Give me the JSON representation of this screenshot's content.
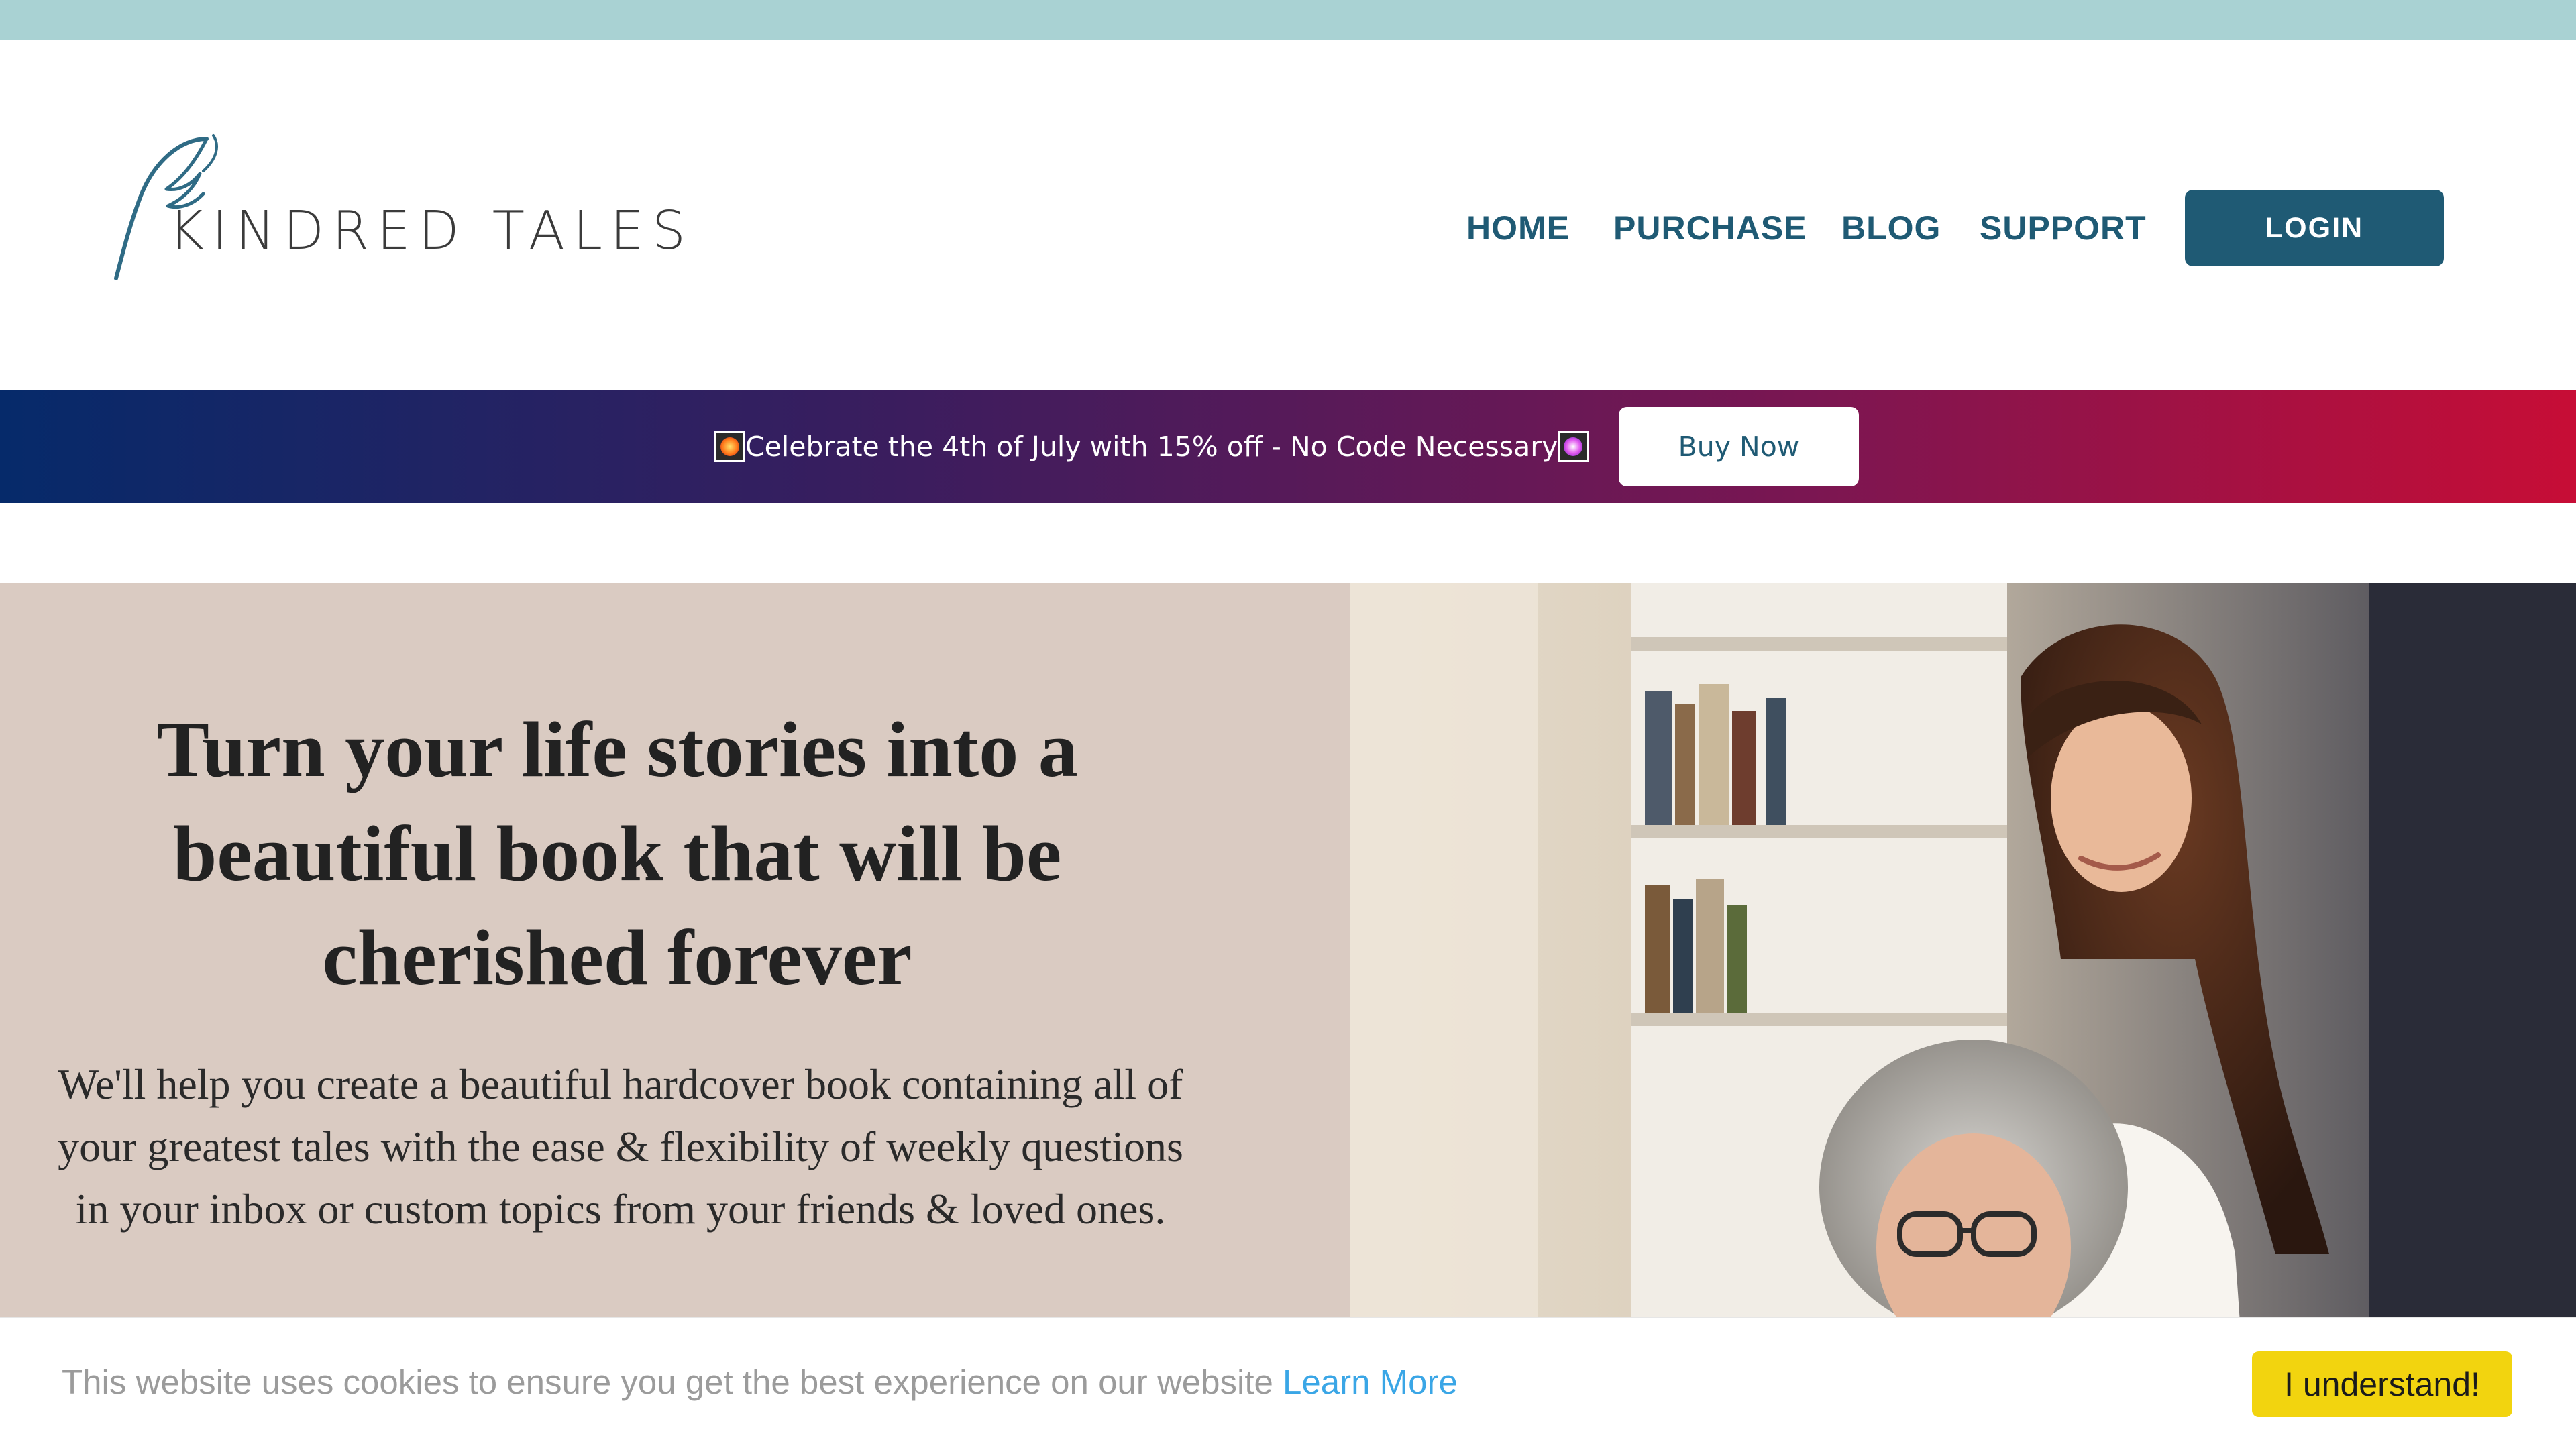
{
  "brand": {
    "name": "KINDRED TALES",
    "colors": {
      "primary": "#1f5a74",
      "top_bar": "#a9d2d3",
      "hero_bg": "#dacbc2",
      "cookie_button": "#f2d40f",
      "link": "#3aa6e6"
    }
  },
  "nav": {
    "items": [
      {
        "label": "HOME"
      },
      {
        "label": "PURCHASE"
      },
      {
        "label": "BLOG"
      },
      {
        "label": "SUPPORT"
      }
    ],
    "login_label": "LOGIN"
  },
  "promo": {
    "text": "Celebrate the 4th of July with 15% off - No Code Necessary",
    "button_label": "Buy Now",
    "icons": [
      "firework-emoji-icon",
      "sparkler-emoji-icon"
    ]
  },
  "hero": {
    "title": "Turn your life stories into a beautiful book that will be cherished forever",
    "subtitle": "We'll help you create a beautiful hardcover book containing all of your greatest tales with the ease & flexibility of weekly questions in your inbox or custom topics from your friends & loved ones."
  },
  "cookie": {
    "text": "This website uses cookies to ensure you get the best experience on our website",
    "link_label": "Learn More",
    "button_label": "I understand!"
  }
}
